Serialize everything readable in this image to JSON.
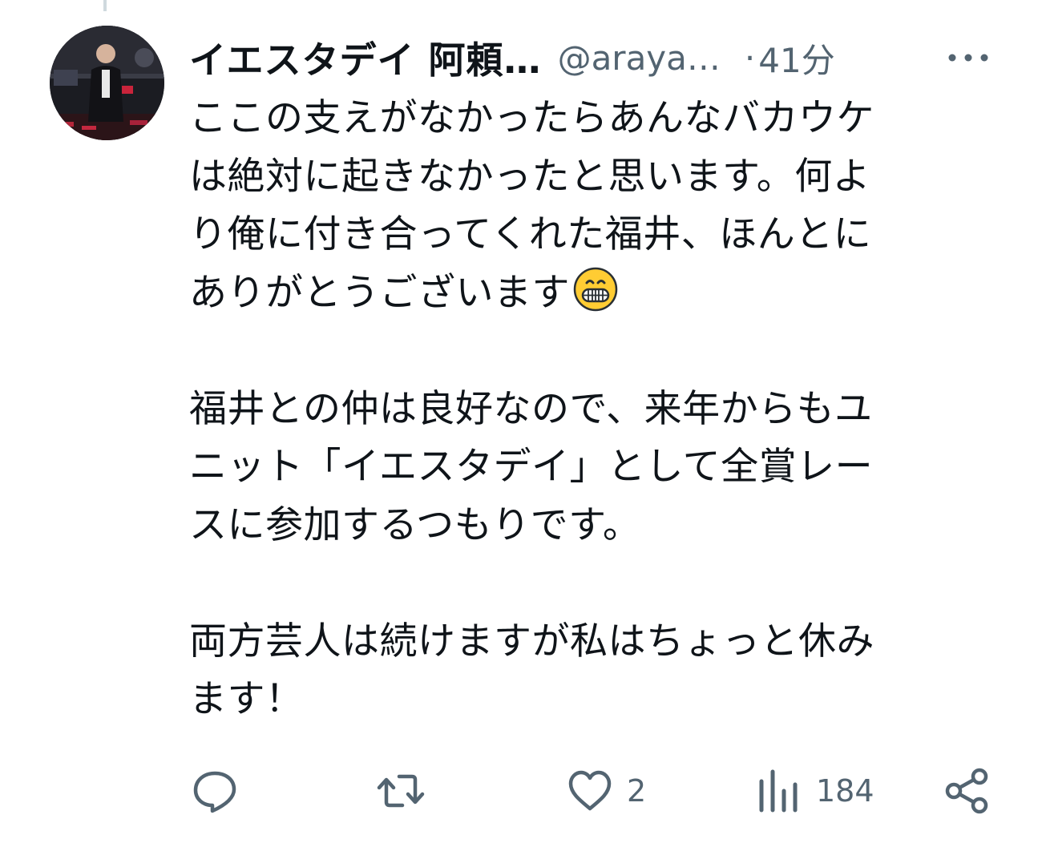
{
  "author": {
    "name": "イエスタデイ 阿頼…",
    "handle": "@araya…",
    "separator": "·",
    "time": "41分"
  },
  "tweet": {
    "paragraphs": [
      [
        "ここの支えがなかったらあんなバカウケ",
        "は絶対に起きなかったと思います。何よ",
        "り俺に付き合ってくれた福井、ほんとに",
        "ありがとうございます"
      ],
      [
        "福井との仲は良好なので、来年からもユ",
        "ニット「イエスタデイ」として全賞レー",
        "スに参加するつもりです。"
      ],
      [
        "両方芸人は続けますが私はちょっと休み",
        "ます！"
      ]
    ],
    "emoji": "grinning-face-icon"
  },
  "actions": {
    "reply_count": "",
    "retweet_count": "",
    "like_count": "2",
    "views_count": "184"
  },
  "colors": {
    "text": "#0f1419",
    "secondary": "#536471",
    "thread_line": "#cfd9de"
  }
}
